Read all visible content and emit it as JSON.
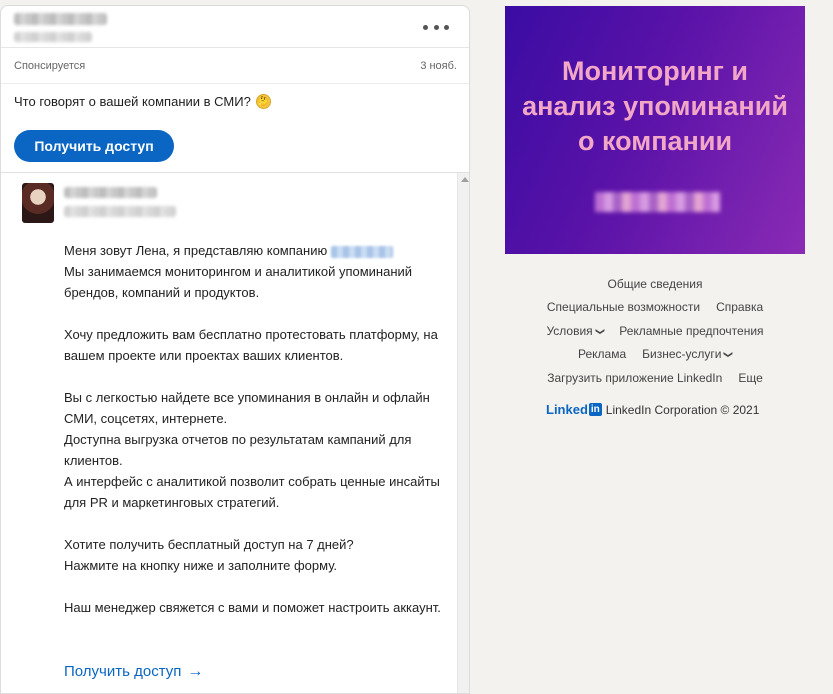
{
  "ad": {
    "sponsored_label": "Спонсируется",
    "date": "3 нояб.",
    "question": "Что говорят о вашей компании в СМИ?",
    "emoji": "🤔",
    "cta_button": "Получить доступ"
  },
  "message": {
    "paragraphs": [
      [
        "Меня зовут Лена, я представляю компанию",
        "Мы занимаемся мониторингом и аналитикой упоминаний брендов, компаний и продуктов."
      ],
      "Хочу предложить вам бесплатно протестовать платформу, на вашем проекте или проектах ваших клиентов.",
      "Вы с легкостью найдете все упоминания в онлайн и офлайн СМИ, соцсетях, интернете.",
      "Доступна выгрузка отчетов по результатам кампаний для клиентов.",
      "А интерфейс с аналитикой позволит собрать ценные инсайты для PR и маркетинговых стратегий.",
      "Хотите получить бесплатный доступ на 7 дней?",
      "Нажмите на кнопку ниже и заполните форму.",
      "Наш менеджер свяжется с вами и поможет настроить аккаунт."
    ],
    "link_cta": "Получить доступ",
    "arrow": "→"
  },
  "promo": {
    "title": "Мониторинг и\nанализ упоминаний\nо компании"
  },
  "footer": {
    "about": "Общие сведения",
    "accessibility": "Специальные возможности",
    "help": "Справка",
    "terms": "Условия",
    "ad_prefs": "Рекламные предпочтения",
    "advertising": "Реклама",
    "business": "Бизнес-услуги",
    "get_app": "Загрузить приложение LinkedIn",
    "more": "Еще",
    "logo_text": "Linked",
    "logo_in": "in",
    "copyright": "LinkedIn Corporation © 2021"
  },
  "colors": {
    "accent": "#0a66c2",
    "promo_text": "#f2a7c7",
    "promo_bg_start": "#3a0ca3",
    "promo_bg_end": "#8a2bb5"
  }
}
